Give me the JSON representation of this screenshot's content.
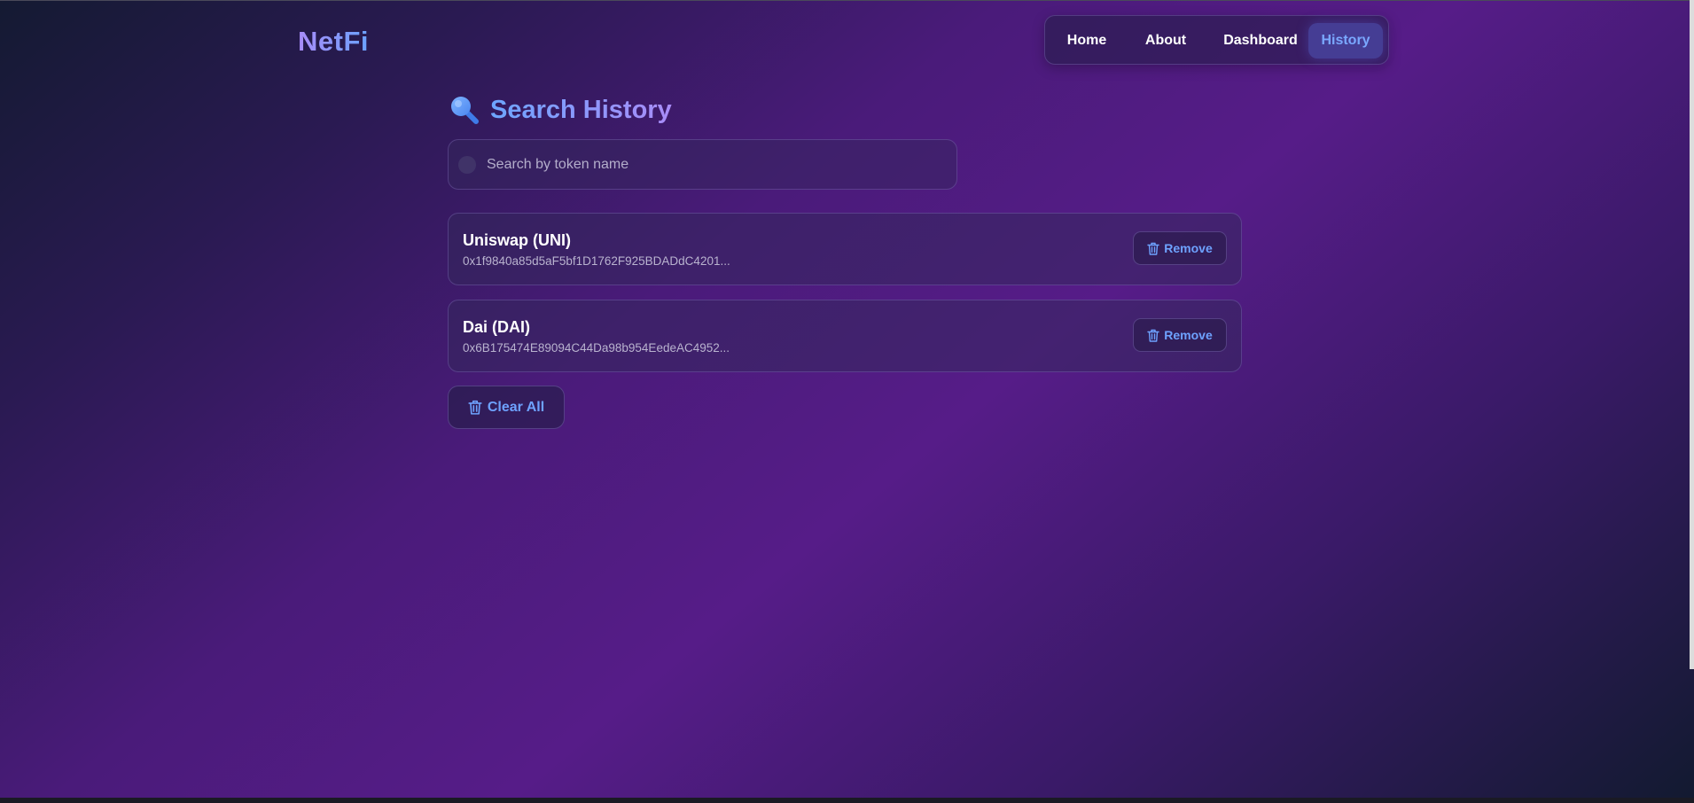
{
  "header": {
    "logo": "NetFi",
    "nav": [
      {
        "label": "Home",
        "active": false
      },
      {
        "label": "About",
        "active": false
      },
      {
        "label": "Dashboard",
        "active": false
      },
      {
        "label": "History",
        "active": true
      }
    ]
  },
  "main": {
    "title": "Search History",
    "title_icon": "magnifier-icon",
    "search": {
      "placeholder": "Search by token name",
      "value": ""
    },
    "items": [
      {
        "name": "Uniswap (UNI)",
        "address": "0x1f9840a85d5aF5bf1D1762F925BDADdC4201...",
        "action": "Remove",
        "action_icon": "trash-icon"
      },
      {
        "name": "Dai (DAI)",
        "address": "0x6B175474E89094C44Da98b954EedeAC4952...",
        "action": "Remove",
        "action_icon": "trash-icon"
      }
    ],
    "clear_all": "Clear All"
  },
  "colors": {
    "accent": "#6ea2ff",
    "logo_gradient_start": "#a98cf8",
    "background_mid": "#561c88",
    "background_edge": "#141a32"
  }
}
